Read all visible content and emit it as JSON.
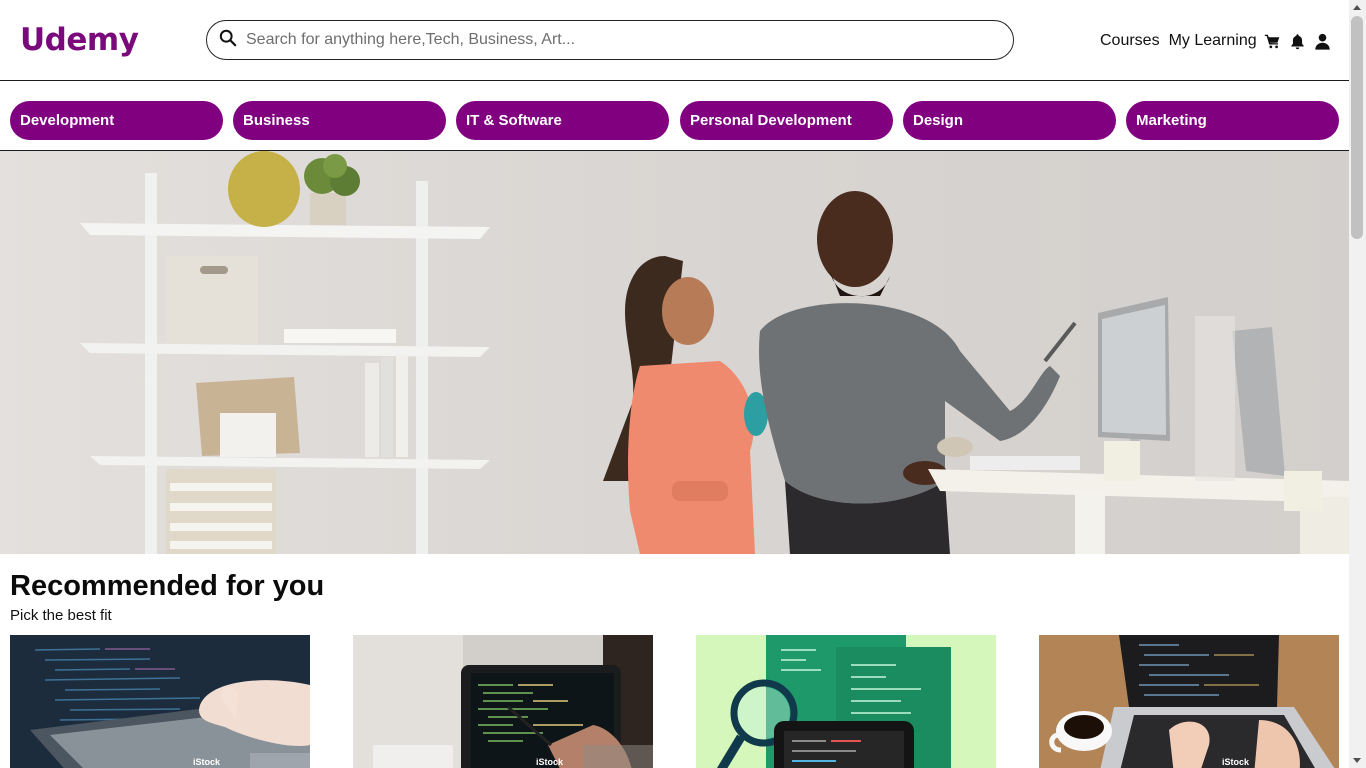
{
  "header": {
    "logo": "Udemy",
    "search_placeholder": "Search for anything here,Tech, Business, Art...",
    "links": [
      "Courses",
      "My Learning"
    ],
    "icons": [
      "cart-icon",
      "bell-icon",
      "user-icon"
    ]
  },
  "categories": [
    "Development",
    "Business",
    "IT & Software",
    "Personal Development",
    "Design",
    "Marketing"
  ],
  "recommended": {
    "title": "Recommended for you",
    "subtitle": "Pick the best fit",
    "cards": [
      {
        "watermark": "iStock"
      },
      {
        "watermark": "iStock"
      },
      {
        "watermark": ""
      },
      {
        "watermark": "iStock"
      }
    ]
  },
  "colors": {
    "brand": "#7a0a7c",
    "pill": "#800080"
  }
}
